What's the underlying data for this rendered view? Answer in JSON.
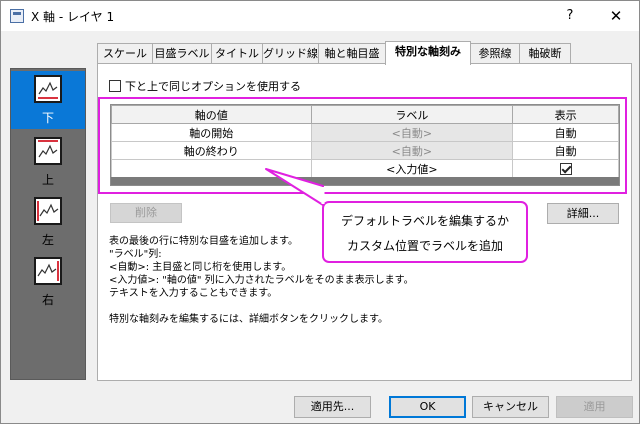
{
  "window": {
    "title": "X 軸 - レイヤ 1",
    "help_label": "?",
    "close_label": "✕"
  },
  "sidebar": {
    "items": [
      {
        "label": "下",
        "selected": true
      },
      {
        "label": "上",
        "selected": false
      },
      {
        "label": "左",
        "selected": false
      },
      {
        "label": "右",
        "selected": false
      }
    ]
  },
  "tabs": [
    {
      "label": "スケール"
    },
    {
      "label": "目盛ラベル"
    },
    {
      "label": "タイトル"
    },
    {
      "label": "グリッド線"
    },
    {
      "label": "軸と軸目盛"
    },
    {
      "label": "特別な軸刻み",
      "active": true
    },
    {
      "label": "参照線"
    },
    {
      "label": "軸破断"
    }
  ],
  "panel": {
    "same_option_checkbox": {
      "label": "下と上で同じオプションを使用する",
      "checked": false
    },
    "table": {
      "headers": [
        "軸の値",
        "ラベル",
        "表示"
      ],
      "rows": [
        {
          "value": "軸の開始",
          "label": "<自動>",
          "show": "自動"
        },
        {
          "value": "軸の終わり",
          "label": "<自動>",
          "show": "自動"
        },
        {
          "value": "",
          "label": "<入力値>",
          "show_checked": true
        }
      ]
    },
    "delete_label": "削除",
    "details_label": "詳細...",
    "info_lines": [
      "表の最後の行に特別な目盛を追加します。",
      "\"ラベル\"列:",
      "<自動>: 主目盛と同じ桁を使用します。",
      "<入力値>: \"軸の値\" 列に入力されたラベルをそのまま表示します。",
      "テキストを入力することもできます。",
      "",
      "特別な軸刻みを編集するには、詳細ボタンをクリックします。"
    ]
  },
  "callout": {
    "line1": "デフォルトラベルを編集するか",
    "line2": "カスタム位置でラベルを追加"
  },
  "buttons": {
    "apply_to": "適用先...",
    "ok": "OK",
    "cancel": "キャンセル",
    "apply": "適用"
  },
  "colors": {
    "accent": "#0a78d7",
    "highlight": "#e020e0",
    "sidebar_bg": "#6d6d6d"
  }
}
